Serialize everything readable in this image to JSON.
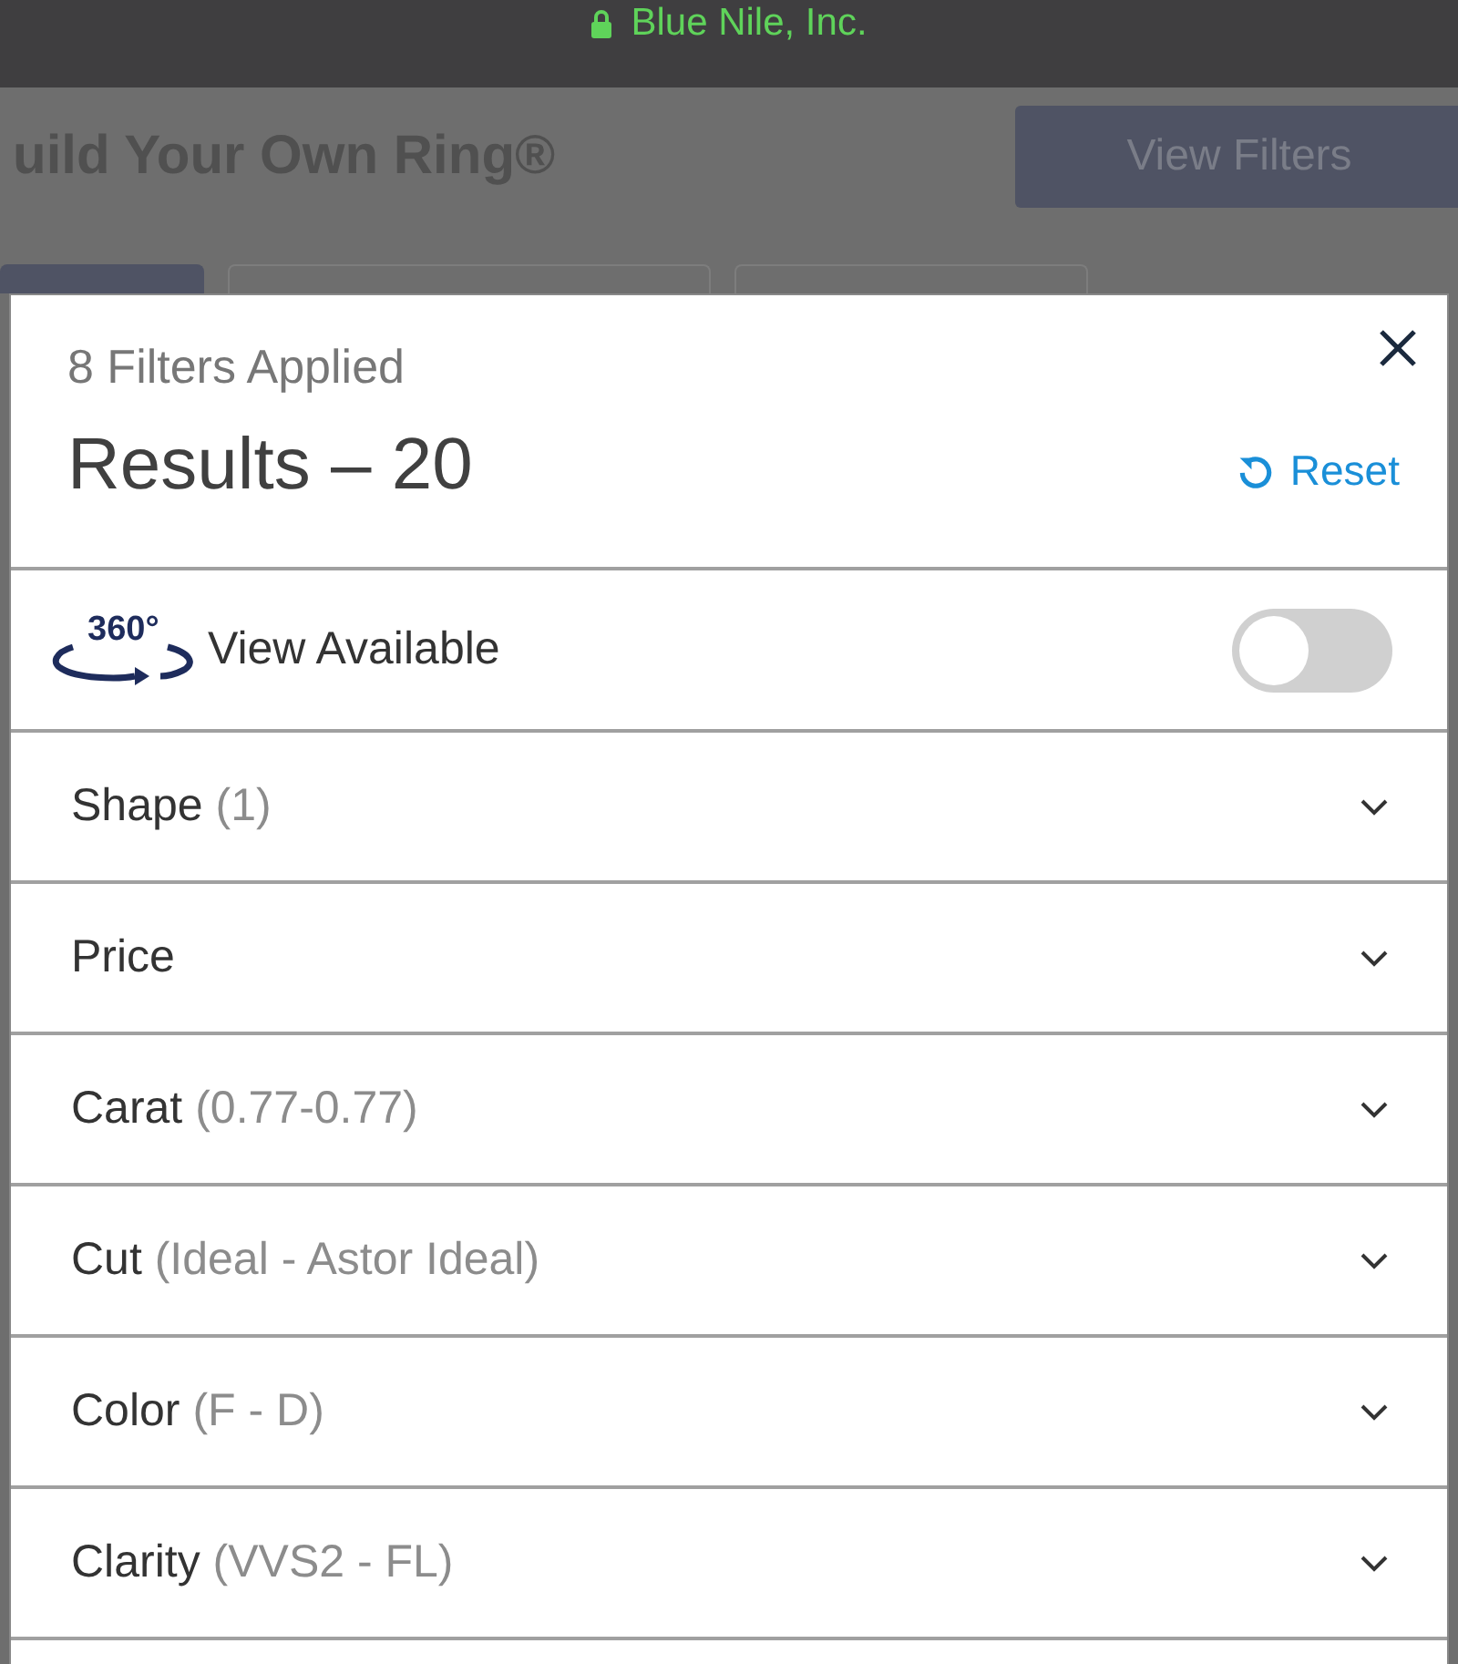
{
  "status_bar": {
    "site": "Blue Nile, Inc."
  },
  "page": {
    "title": "uild Your Own Ring®",
    "button": "View Filters",
    "tabs": [
      {
        "selected": true
      },
      {
        "selected": false
      },
      {
        "selected": false
      }
    ]
  },
  "filter_panel": {
    "applied": "8 Filters Applied",
    "results": "Results – 20",
    "reset": "Reset",
    "view_toggle": {
      "badge": "360°",
      "label": "View Available",
      "on": false
    },
    "filters": [
      {
        "name": "Shape",
        "value": "(1)"
      },
      {
        "name": "Price"
      },
      {
        "name": "Carat",
        "value": "(0.77-0.77)"
      },
      {
        "name": "Cut",
        "value": "(Ideal - Astor Ideal)"
      },
      {
        "name": "Color",
        "value": "(F - D)"
      },
      {
        "name": "Clarity",
        "value": "(VVS2 - FL)"
      }
    ]
  }
}
